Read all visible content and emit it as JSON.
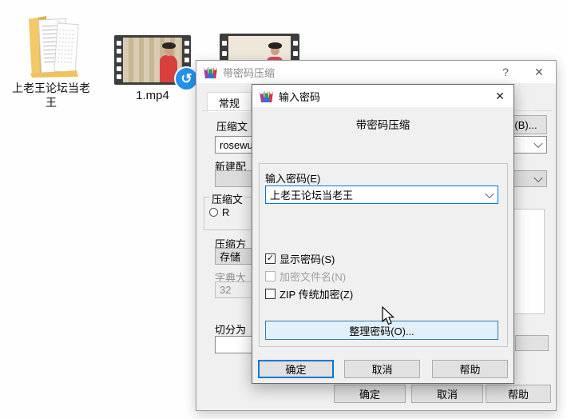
{
  "desktop": {
    "folder": {
      "label_line1": "上老王论坛当老",
      "label_line2": "王"
    },
    "video1": {
      "label": "1.mp4",
      "overlay_icon": "sync-arrow-icon",
      "overlay_glyph": "↺"
    }
  },
  "compress_dialog": {
    "title": "带密码压缩",
    "help_glyph": "?",
    "close_glyph": "✕",
    "tab": "常规",
    "fields": {
      "archive_label": "压缩文",
      "archive_value": "rosewu",
      "profile_label": "新建配",
      "format_group_label": "压缩文",
      "radio_label": "R",
      "method_label": "压缩方",
      "method_value": "存储",
      "dict_label": "字典大",
      "dict_value": "32",
      "split_label": "切分为",
      "browse_label": "(B)..."
    },
    "buttons": {
      "ok": "确定",
      "cancel": "取消",
      "help": "帮助"
    }
  },
  "password_dialog": {
    "title": "输入密码",
    "close_glyph": "✕",
    "header": "带密码压缩",
    "password_label": "输入密码(E)",
    "password_value": "上老王论坛当老王",
    "check_glyph": "✓",
    "checkboxes": [
      {
        "label": "显示密码(S)",
        "checked": true,
        "disabled": false
      },
      {
        "label": "加密文件名(N)",
        "checked": false,
        "disabled": true
      },
      {
        "label": "ZIP 传统加密(Z)",
        "checked": false,
        "disabled": false
      }
    ],
    "organize_button": "整理密码(O)...",
    "buttons": {
      "ok": "确定",
      "cancel": "取消",
      "help": "帮助"
    }
  },
  "colors": {
    "accent": "#0078d7",
    "dialog_bg": "#f0f0f0",
    "titlebar_bg": "#ffffff",
    "organize_fill": "#e1f1fb",
    "badge_blue": "#2492ea"
  }
}
